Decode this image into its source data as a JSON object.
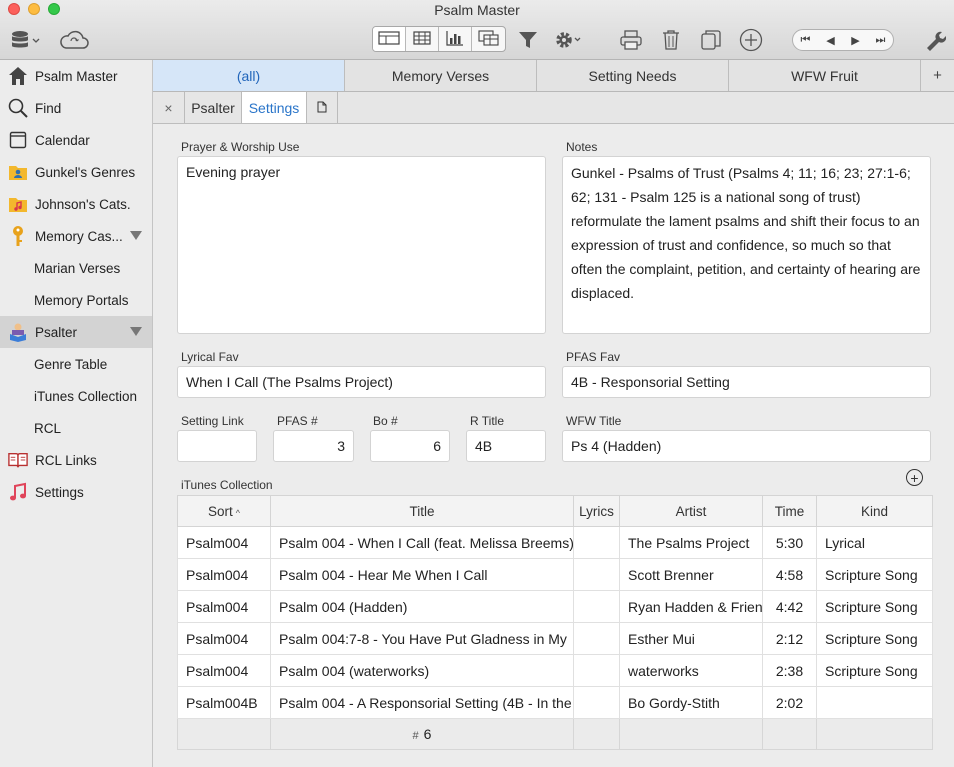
{
  "app": {
    "title": "Psalm Master"
  },
  "toolbar": {
    "icons": [
      "database-icon",
      "cloud-icon",
      "form-view-icon",
      "table-view-icon",
      "chart-view-icon",
      "multi-view-icon",
      "filter-icon",
      "gear-icon",
      "print-icon",
      "trash-icon",
      "duplicate-icon",
      "add-icon",
      "first-record-icon",
      "previous-record-icon",
      "next-record-icon",
      "last-record-icon",
      "wrench-icon"
    ]
  },
  "sidebar": {
    "items": [
      {
        "label": "Psalm Master",
        "icon": "home-icon"
      },
      {
        "label": "Find",
        "icon": "search-icon"
      },
      {
        "label": "Calendar",
        "icon": "calendar-icon"
      },
      {
        "label": "Gunkel's Genres",
        "icon": "folder-person-icon"
      },
      {
        "label": "Johnson's Cats.",
        "icon": "folder-music-icon"
      },
      {
        "label": "Memory Cas...",
        "icon": "key-icon"
      },
      {
        "label": "Marian Verses"
      },
      {
        "label": "Memory Portals"
      },
      {
        "label": "Psalter",
        "icon": "reader-icon"
      },
      {
        "label": "Genre Table"
      },
      {
        "label": "iTunes Collection"
      },
      {
        "label": "RCL"
      },
      {
        "label": "RCL Links",
        "icon": "book-icon"
      },
      {
        "label": "Settings",
        "icon": "music-note-icon"
      }
    ]
  },
  "tabs": [
    "(all)",
    "Memory Verses",
    "Setting Needs",
    "WFW Fruit"
  ],
  "tab_add": "+",
  "subtabs": {
    "close": "×",
    "psalter": "Psalter",
    "settings": "Settings"
  },
  "form": {
    "prayer_label": "Prayer & Worship Use",
    "prayer_value": "Evening prayer",
    "notes_label": "Notes",
    "notes_value": "Gunkel - Psalms of Trust (Psalms 4; 11; 16; 23; 27:1-6; 62; 131 - Psalm 125 is a national song of trust) reformulate the lament psalms and shift their focus to an expression of trust and confidence, so much so that often the complaint, petition, and certainty of hearing are displaced.",
    "lyrical_fav_label": "Lyrical Fav",
    "lyrical_fav_value": "When I Call (The Psalms Project)",
    "pfas_fav_label": "PFAS Fav",
    "pfas_fav_value": "4B - Responsorial Setting",
    "setting_link_label": "Setting Link",
    "setting_link_value": "",
    "pfas_num_label": "PFAS #",
    "pfas_num_value": "3",
    "bo_num_label": "Bo #",
    "bo_num_value": "6",
    "r_title_label": "R Title",
    "r_title_value": "4B",
    "wfw_title_label": "WFW Title",
    "wfw_title_value": "Ps 4 (Hadden)"
  },
  "itunes": {
    "label": "iTunes Collection",
    "add_button": "+",
    "columns": [
      "Sort",
      "Title",
      "Lyrics",
      "Artist",
      "Time",
      "Kind"
    ],
    "sort_indicator": "^",
    "rows": [
      [
        "Psalm004",
        "Psalm 004 - When I Call (feat. Melissa Breems)",
        "",
        "The Psalms Project",
        "5:30",
        "Lyrical"
      ],
      [
        "Psalm004",
        "Psalm 004 - Hear Me When I Call",
        "",
        "Scott Brenner",
        "4:58",
        "Scripture Song"
      ],
      [
        "Psalm004",
        "Psalm 004 (Hadden)",
        "",
        "Ryan Hadden & Friends",
        "4:42",
        "Scripture Song"
      ],
      [
        "Psalm004",
        "Psalm 004:7-8 - You Have Put Gladness in My",
        "",
        "Esther Mui",
        "2:12",
        "Scripture Song"
      ],
      [
        "Psalm004",
        "Psalm 004 (waterworks)",
        "",
        "waterworks",
        "2:38",
        "Scripture Song"
      ],
      [
        "Psalm004B",
        "Psalm 004 - A Responsorial Setting (4B - In the",
        "",
        "Bo Gordy-Stith",
        "2:02",
        ""
      ]
    ],
    "footer_hash": "#",
    "footer_count": "6"
  }
}
